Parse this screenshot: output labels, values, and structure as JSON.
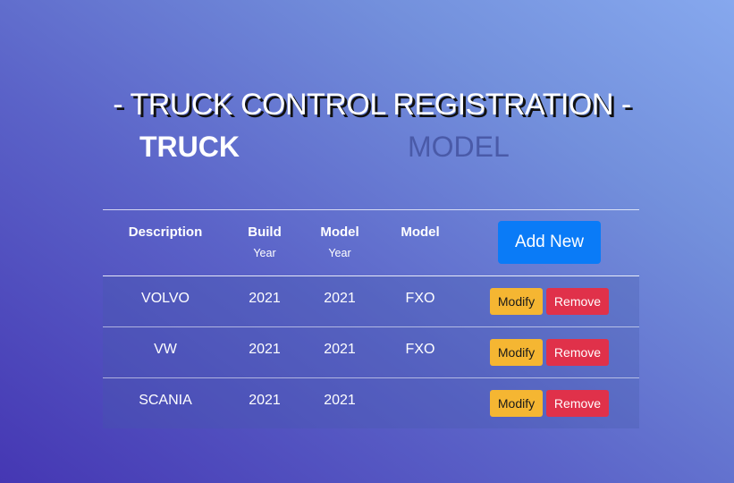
{
  "page": {
    "title": "- TRUCK CONTROL REGISTRATION -"
  },
  "tabs": [
    {
      "label": "TRUCK",
      "active": true
    },
    {
      "label": "MODEL",
      "active": false
    }
  ],
  "table": {
    "headers": {
      "description": "Description",
      "build": "Build",
      "build_sub": "Year",
      "model_year": "Model",
      "model_year_sub": "Year",
      "model": "Model"
    },
    "add_label": "Add New",
    "rows": [
      {
        "description": "VOLVO",
        "build_year": "2021",
        "model_year": "2021",
        "model": "FXO"
      },
      {
        "description": "VW",
        "build_year": "2021",
        "model_year": "2021",
        "model": "FXO"
      },
      {
        "description": "SCANIA",
        "build_year": "2021",
        "model_year": "2021",
        "model": ""
      }
    ],
    "modify_label": "Modify",
    "remove_label": "Remove"
  },
  "colors": {
    "add_button": "#0a7bf7",
    "modify_button": "#f5b632",
    "remove_button": "#e0314a",
    "inactive_tab": "#4a5aa8"
  }
}
